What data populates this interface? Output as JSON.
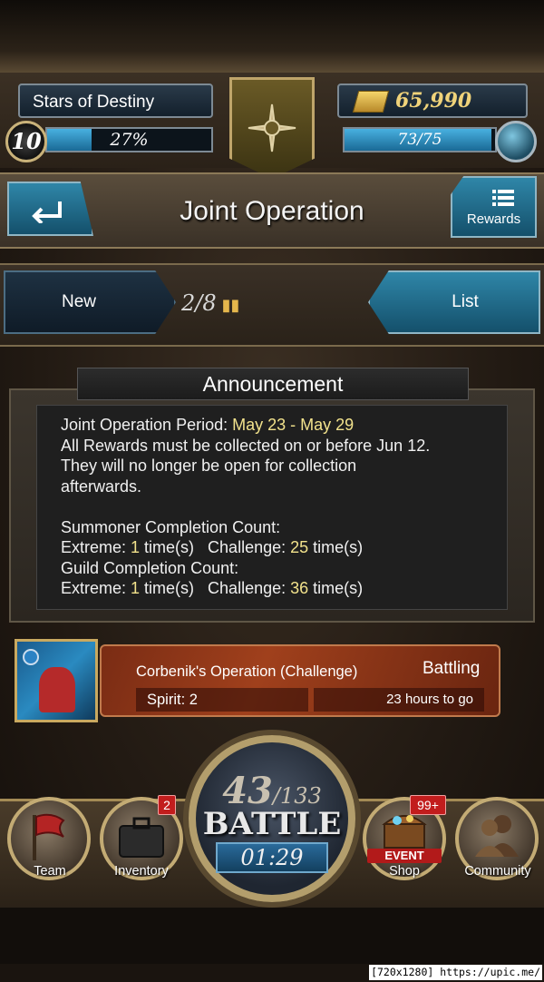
{
  "hud": {
    "player_name": "Stars of Destiny",
    "level": "10",
    "xp_percent_text": "27%",
    "xp_progress": 0.27,
    "gold": "65,990",
    "stamina_text": "73/75",
    "stamina_progress": 0.973
  },
  "header": {
    "title": "Joint Operation",
    "rewards_label": "Rewards"
  },
  "tabs": {
    "new_label": "New",
    "counter": "2/8",
    "list_label": "List"
  },
  "announcement": {
    "title": "Announcement",
    "period_label": "Joint Operation Period: ",
    "period_value": "May 23 - May 29",
    "line2": "All Rewards must be collected on or before Jun 12.",
    "line3": "They will no longer be open for collection",
    "line4": "afterwards.",
    "summoner_heading": "Summoner Completion Count:",
    "summoner_extreme_label": "Extreme: ",
    "summoner_extreme_value": "1",
    "summoner_extreme_suffix": " time(s)   Challenge: ",
    "summoner_challenge_value": "25",
    "summoner_challenge_suffix": " time(s)",
    "guild_heading": "Guild Completion Count:",
    "guild_extreme_label": "Extreme: ",
    "guild_extreme_value": "1",
    "guild_extreme_suffix": " time(s)   Challenge: ",
    "guild_challenge_value": "36",
    "guild_challenge_suffix": " time(s)"
  },
  "operation": {
    "title": "Corbenik's Operation (Challenge)",
    "status": "Battling",
    "spirit": "Spirit: 2",
    "time_left": "23 hours to go"
  },
  "battle": {
    "current": "43",
    "total": "/133",
    "label": "BATTLE",
    "timer": "01:29"
  },
  "nav": {
    "team": "Team",
    "inventory": "Inventory",
    "inventory_badge": "2",
    "shop": "Shop",
    "shop_badge": "99+",
    "shop_event": "EVENT",
    "community": "Community"
  },
  "watermark": "[720x1280] https://upic.me/",
  "colors": {
    "highlight": "#f2e28c",
    "accent_blue": "#2f86a8",
    "gold_text": "#f0d37a",
    "badge_red": "#c21d1d"
  }
}
